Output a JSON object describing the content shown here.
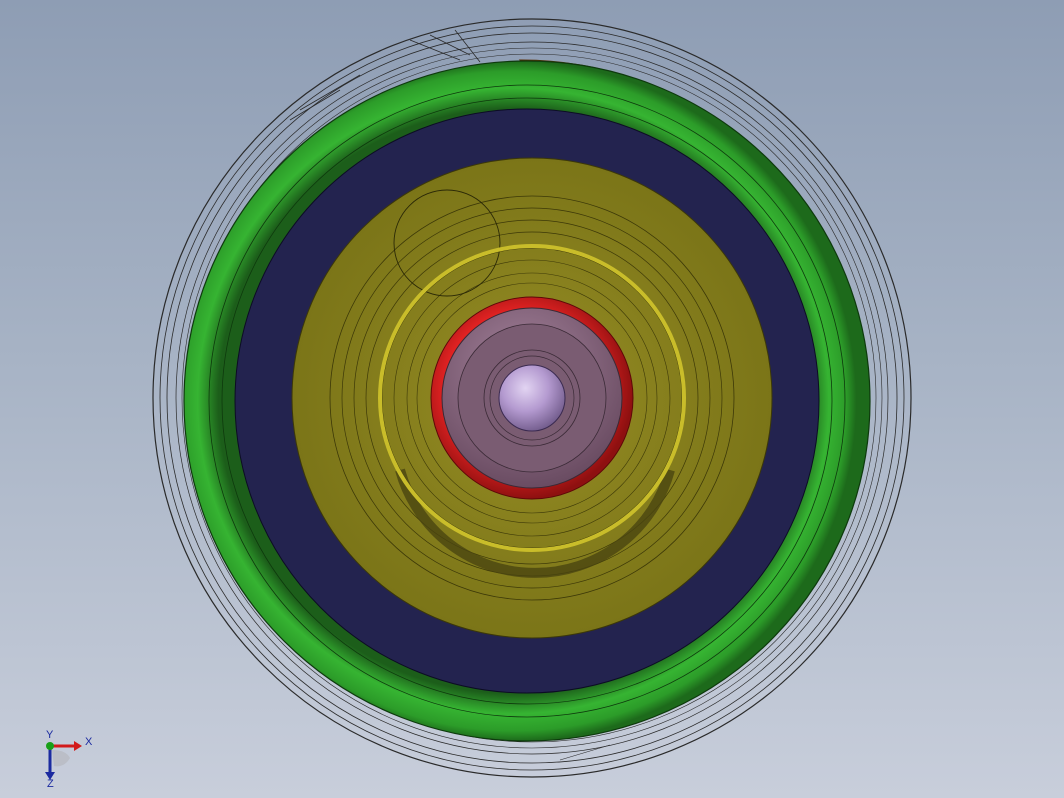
{
  "viewport": {
    "background_top": "#8e9db4",
    "background_bottom": "#c8cedb"
  },
  "model": {
    "colors": {
      "wire": "#2a2a2a",
      "orange_part": "#e07818",
      "green_ring": "#2fa82c",
      "navy_ring": "#23234f",
      "olive_disc": "#8b8420",
      "yellow_ring": "#c9bd2a",
      "red_ring": "#d01818",
      "mauve_hub": "#8a6a80",
      "lavender_cone": "#b49ad0"
    }
  },
  "triad": {
    "x_label": "X",
    "y_label": "Y",
    "z_label": "Z",
    "x_color": "#d21a1a",
    "y_color": "#18a018",
    "z_color": "#1b2aa0"
  }
}
